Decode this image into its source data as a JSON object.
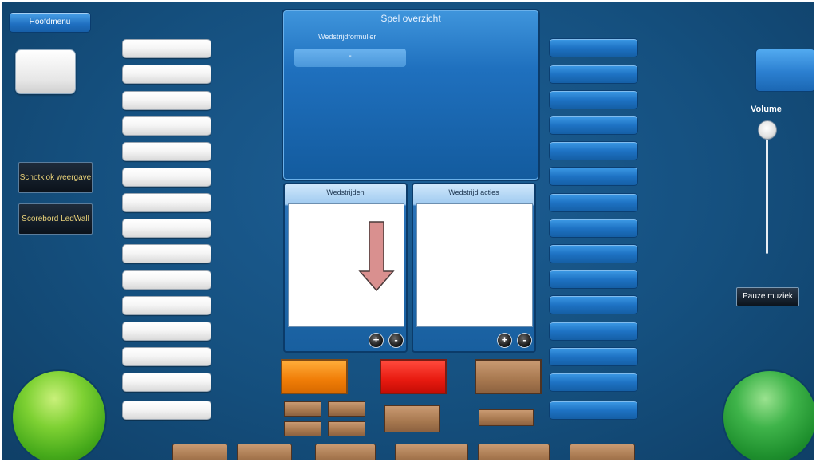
{
  "header": {
    "main_menu_label": "Hoofdmenu"
  },
  "left_panel": {
    "shot_clock_label": "Schotklok weergave",
    "scoreboard_label": "Scorebord LedWall"
  },
  "overview": {
    "title": "Spel overzicht",
    "form_label": "Wedstrijdformulier",
    "form_select_value": "-"
  },
  "matches_panel": {
    "title": "Wedstrijden",
    "add_label": "+",
    "remove_label": "-"
  },
  "actions_panel": {
    "title": "Wedstrijd acties",
    "add_label": "+",
    "remove_label": "-"
  },
  "volume": {
    "label": "Volume",
    "level_fraction": 1.0
  },
  "music": {
    "pause_label": "Pauze muziek"
  },
  "colors": {
    "background": "#15507f",
    "orange": "#f07d07",
    "red": "#e81a10",
    "brown": "#a7784f",
    "green": "#45a91a"
  },
  "annotation": {
    "arrow_icon": "arrow-down-icon",
    "arrow_color": "#d9908f"
  }
}
